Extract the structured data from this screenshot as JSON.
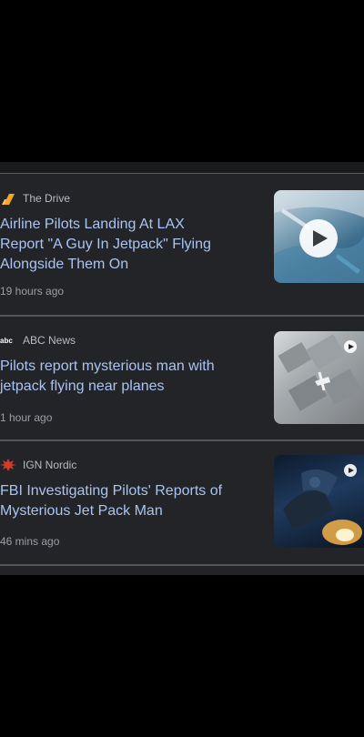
{
  "articles": [
    {
      "source": "The Drive",
      "headline_lines": [
        "Airline Pilots Landing At LAX",
        "Report \"A Guy In Jetpack\" Flying",
        "Alongside Them On"
      ],
      "time": "19 hours ago",
      "logo_icon": "the-drive-logo",
      "media": "video"
    },
    {
      "source": "ABC News",
      "headline_lines": [
        "Pilots report mysterious man with",
        "jetpack flying near planes"
      ],
      "time": "1 hour ago",
      "logo_icon": "abc-logo",
      "media": "video"
    },
    {
      "source": "IGN Nordic",
      "headline_lines": [
        "FBI Investigating Pilots' Reports of",
        "Mysterious Jet Pack Man"
      ],
      "time": "46 mins ago",
      "logo_icon": "ign-logo",
      "media": "video"
    }
  ],
  "colors": {
    "headline": "#a9c4f2",
    "source": "#b8bbc2",
    "meta": "#9c9fa6",
    "card_bg": "#232427",
    "divider": "#55565a"
  }
}
